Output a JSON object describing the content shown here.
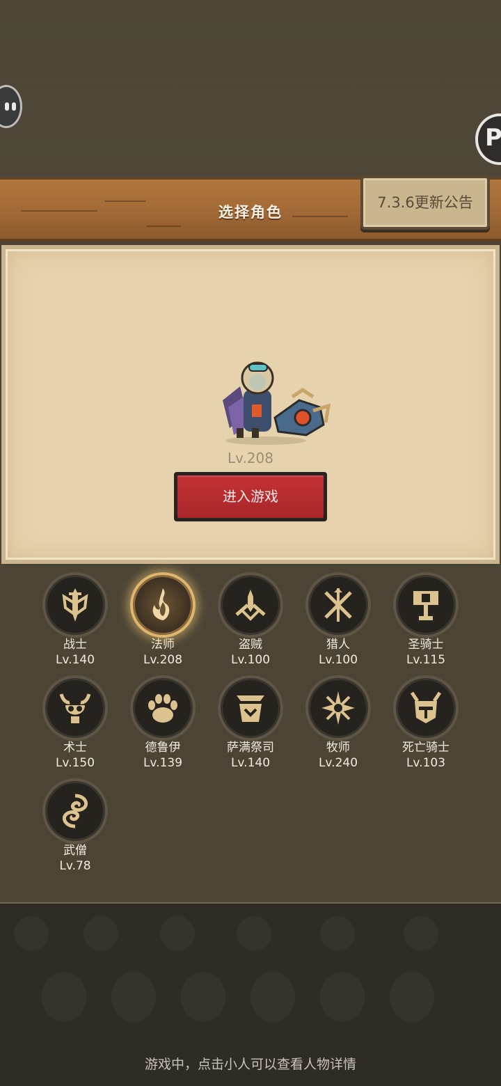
{
  "title": "选择角色",
  "notice_button": "7.3.6更新公告",
  "selected": {
    "level": "Lv.208",
    "enter_label": "进入游戏"
  },
  "classes": [
    {
      "name": "战士",
      "level": "Lv.140",
      "icon": "sword-shield-icon"
    },
    {
      "name": "法师",
      "level": "Lv.208",
      "icon": "flame-icon",
      "selected": true
    },
    {
      "name": "盗贼",
      "level": "Lv.100",
      "icon": "crossed-daggers-icon"
    },
    {
      "name": "猎人",
      "level": "Lv.100",
      "icon": "crossed-arrows-icon"
    },
    {
      "name": "圣骑士",
      "level": "Lv.115",
      "icon": "hammer-icon"
    },
    {
      "name": "术士",
      "level": "Lv.150",
      "icon": "horned-skull-icon"
    },
    {
      "name": "德鲁伊",
      "level": "Lv.139",
      "icon": "paw-icon"
    },
    {
      "name": "萨满祭司",
      "level": "Lv.140",
      "icon": "totem-icon"
    },
    {
      "name": "牧师",
      "level": "Lv.240",
      "icon": "star-burst-icon"
    },
    {
      "name": "死亡骑士",
      "level": "Lv.103",
      "icon": "helmet-icon"
    },
    {
      "name": "武僧",
      "level": "Lv.78",
      "icon": "swirl-icon"
    }
  ],
  "hint": "游戏中，点击小人可以查看人物详情",
  "colors": {
    "gold": "#dcc28f",
    "enter_red": "#b82a2c",
    "parchment": "#e6d3ad"
  }
}
